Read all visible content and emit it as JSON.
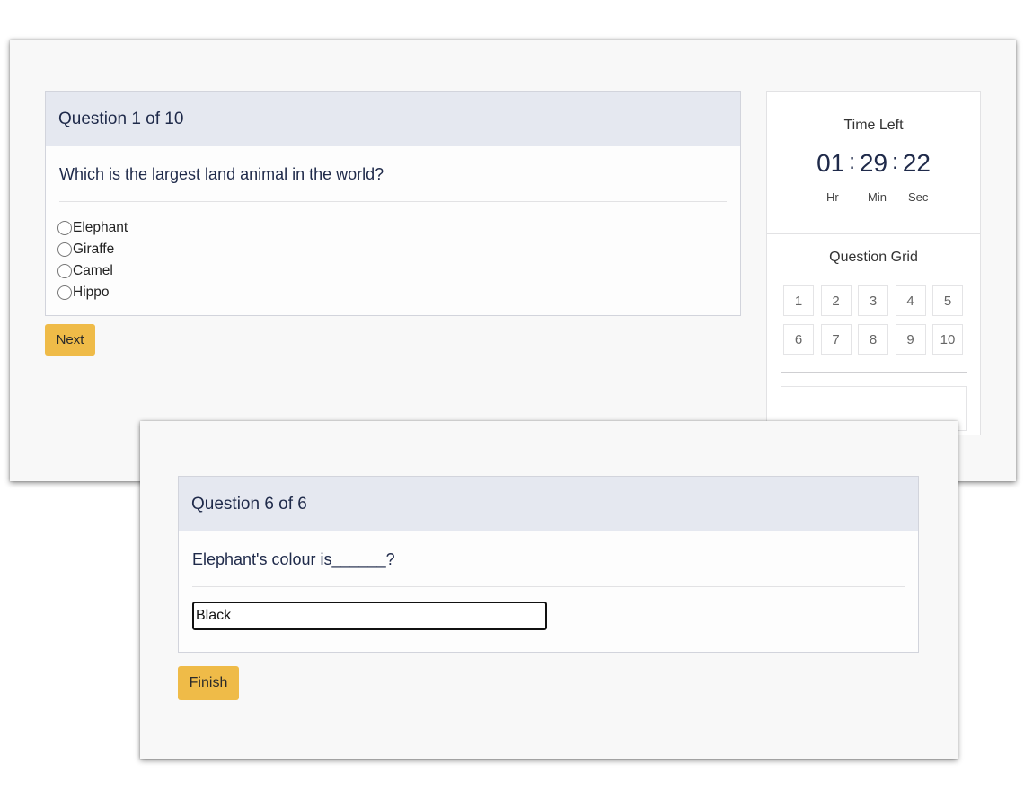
{
  "quiz_window_1": {
    "question": {
      "header": "Question 1 of 10",
      "text": "Which is the largest land animal in the world?",
      "options": [
        "Elephant",
        "Giraffe",
        "Camel",
        "Hippo"
      ]
    },
    "next_label": "Next",
    "sidebar": {
      "timer": {
        "title": "Time Left",
        "hours": "01",
        "minutes": "29",
        "seconds": "22",
        "separator": ":",
        "hours_label": "Hr",
        "minutes_label": "Min",
        "seconds_label": "Sec"
      },
      "grid": {
        "title": "Question Grid",
        "numbers": [
          "1",
          "2",
          "3",
          "4",
          "5",
          "6",
          "7",
          "8",
          "9",
          "10"
        ]
      }
    }
  },
  "quiz_window_2": {
    "question": {
      "header": "Question 6 of 6",
      "text": "Elephant's colour is______?",
      "answer_value": "Black"
    },
    "finish_label": "Finish"
  },
  "colors": {
    "accent_button": "#efbb48",
    "card_header_bg": "#e5e8f0",
    "text_primary": "#1f2a4a"
  }
}
